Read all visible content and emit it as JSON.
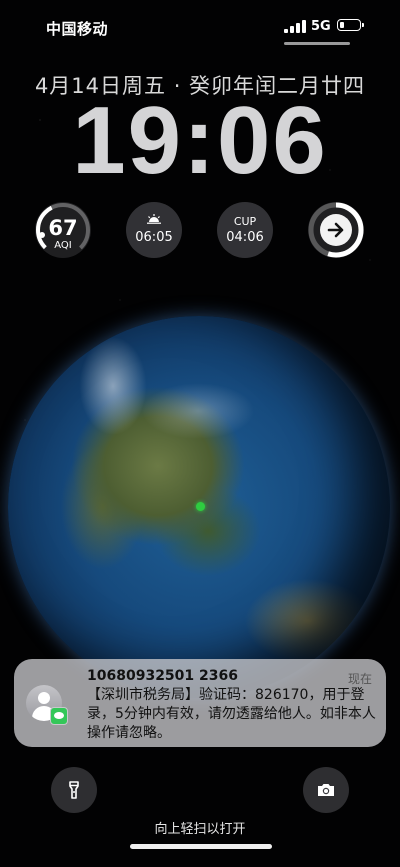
{
  "status_bar": {
    "carrier": "中国移动",
    "network": "5G",
    "battery_level": 0.25
  },
  "lock_screen": {
    "date": "4月14日周五 · 癸卯年闰二月廿四",
    "time": "19:06"
  },
  "widgets": {
    "aqi": {
      "value": "67",
      "label": "AQI",
      "gauge_fraction": 0.4
    },
    "sunrise": {
      "icon": "sunrise-icon",
      "time": "06:05"
    },
    "cup": {
      "label": "CUP",
      "time": "04:06"
    },
    "ring": {
      "icon": "arrow-right-icon",
      "fraction": 0.55
    }
  },
  "notification": {
    "title": "10680932501 2366",
    "time": "现在",
    "body": "【深圳市税务局】验证码：826170，用于登录，5分钟内有效，请勿透露给他人。如非本人操作请忽略。",
    "app_icon": "messages-icon",
    "avatar_icon": "contact-avatar-icon"
  },
  "bottom": {
    "flashlight_icon": "flashlight-icon",
    "camera_icon": "camera-icon",
    "swipe_hint": "向上轻扫以打开"
  },
  "colors": {
    "accent_green": "#34c759",
    "location_dot": "#2ecc40"
  }
}
